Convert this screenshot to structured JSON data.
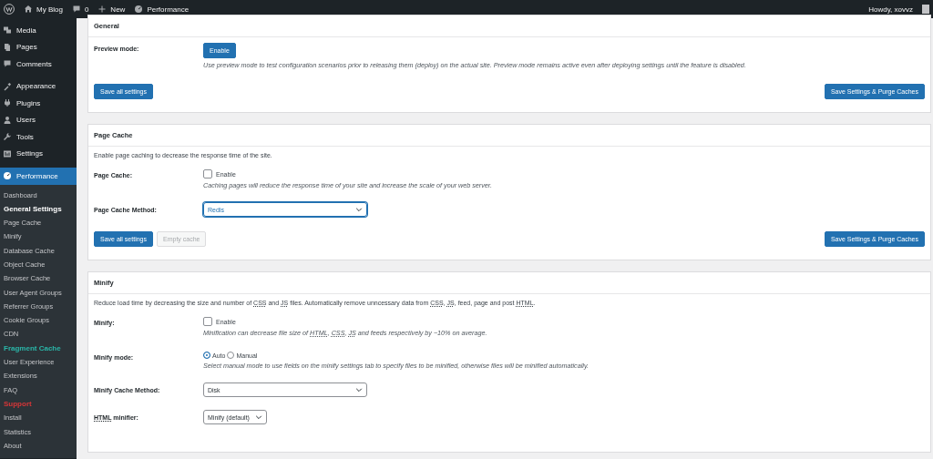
{
  "admin_bar": {
    "site": "My Blog",
    "comments": "0",
    "new": "New",
    "plugin": "Performance",
    "greeting": "Howdy, xovvz"
  },
  "sidebar": {
    "menu": [
      {
        "label": "Media",
        "selected": false
      },
      {
        "label": "Pages",
        "selected": false
      },
      {
        "label": "Comments",
        "selected": false
      },
      {
        "label": "Appearance",
        "selected": false,
        "gap": true
      },
      {
        "label": "Plugins",
        "selected": false
      },
      {
        "label": "Users",
        "selected": false
      },
      {
        "label": "Tools",
        "selected": false
      },
      {
        "label": "Settings",
        "selected": false
      },
      {
        "label": "Performance",
        "selected": true,
        "gap": true
      }
    ],
    "submenu": [
      {
        "label": "Dashboard",
        "selected": false
      },
      {
        "label": "General Settings",
        "selected": true
      },
      {
        "label": "Page Cache",
        "selected": false
      },
      {
        "label": "Minify",
        "selected": false
      },
      {
        "label": "Database Cache",
        "selected": false
      },
      {
        "label": "Object Cache",
        "selected": false
      },
      {
        "label": "Browser Cache",
        "selected": false
      },
      {
        "label": "User Agent Groups",
        "selected": false
      },
      {
        "label": "Referrer Groups",
        "selected": false
      },
      {
        "label": "Cookie Groups",
        "selected": false
      },
      {
        "label": "CDN",
        "selected": false
      },
      {
        "label": "Fragment Cache",
        "selected": false,
        "color": "#2ab7a9"
      },
      {
        "label": "User Experience",
        "selected": false
      },
      {
        "label": "Extensions",
        "selected": false
      },
      {
        "label": "FAQ",
        "selected": false
      },
      {
        "label": "Support",
        "selected": false,
        "color": "#d63638"
      },
      {
        "label": "Install",
        "selected": false
      },
      {
        "label": "Statistics",
        "selected": false
      },
      {
        "label": "About",
        "selected": false
      }
    ]
  },
  "sections": [
    {
      "title": "General",
      "rows": [
        {
          "kind": "button",
          "label": "Preview mode:",
          "button": "Enable",
          "note": "Use preview mode to test configuration scenarios prior to releasing them (deploy) on the actual site. Preview mode remains active even after deploying settings until the feature is disabled."
        }
      ],
      "actions": [
        {
          "label": "Save all settings",
          "disabled": false
        }
      ],
      "purge": "Save Settings & Purge Caches"
    },
    {
      "title": "Page Cache",
      "intro": "Enable page caching to decrease the response time of the site.",
      "rows": [
        {
          "kind": "checkbox",
          "label": "Page Cache:",
          "option": "Enable",
          "checked": false,
          "note": "Caching pages will reduce the response time of your site and increase the scale of your web server."
        },
        {
          "kind": "select",
          "label": "Page Cache Method:",
          "value": "Redis",
          "focused": true
        }
      ],
      "actions": [
        {
          "label": "Save all settings",
          "disabled": false
        },
        {
          "label": "Empty cache",
          "disabled": true
        }
      ],
      "purge": "Save Settings & Purge Caches"
    },
    {
      "title": "Minify",
      "intro": [
        {
          "text": "Reduce load time by decreasing the size and number of "
        },
        {
          "text": "CSS",
          "abbr": true
        },
        {
          "text": " and "
        },
        {
          "text": "JS",
          "abbr": true
        },
        {
          "text": " files. Automatically remove unncessary data from "
        },
        {
          "text": "CSS",
          "abbr": true
        },
        {
          "text": ", "
        },
        {
          "text": "JS",
          "abbr": true
        },
        {
          "text": ", feed, page and post "
        },
        {
          "text": "HTML",
          "abbr": true
        },
        {
          "text": "."
        }
      ],
      "rows": [
        {
          "kind": "checkbox",
          "label": "Minify:",
          "option": "Enable",
          "checked": false,
          "note": [
            {
              "text": "Minification can decrease file size of "
            },
            {
              "text": "HTML",
              "abbr": true
            },
            {
              "text": ", "
            },
            {
              "text": "CSS",
              "abbr": true
            },
            {
              "text": ", "
            },
            {
              "text": "JS",
              "abbr": true
            },
            {
              "text": " and feeds respectively by ~10% on average."
            }
          ]
        },
        {
          "kind": "radio",
          "label": "Minify mode:",
          "options": [
            {
              "label": "Auto",
              "selected": true
            },
            {
              "label": "Manual",
              "selected": false
            }
          ],
          "note": "Select manual mode to use fields on the minify settings tab to specify files to be minified, otherwise files will be minified automatically."
        },
        {
          "kind": "select",
          "label": "Minify Cache Method:",
          "value": "Disk",
          "focused": false
        },
        {
          "kind": "picker",
          "label": [
            {
              "text": "HTML",
              "abbr": true
            },
            {
              "text": " minifier:"
            }
          ],
          "value": "Minify (default)",
          "focused": false
        }
      ]
    }
  ]
}
